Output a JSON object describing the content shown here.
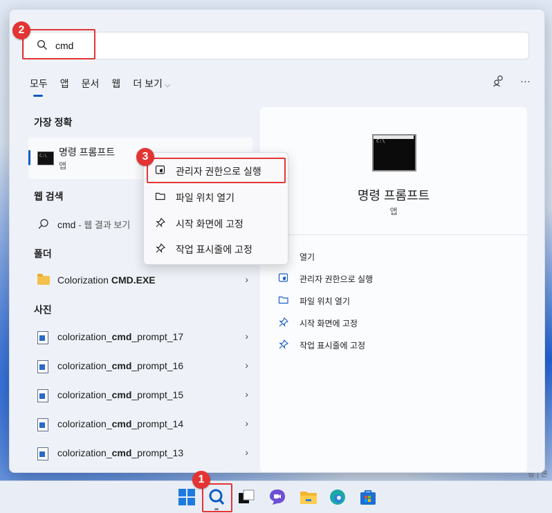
{
  "search": {
    "value": "cmd"
  },
  "tabs": [
    {
      "label": "모두",
      "active": true
    },
    {
      "label": "앱"
    },
    {
      "label": "문서"
    },
    {
      "label": "웹"
    },
    {
      "label": "더 보기"
    }
  ],
  "sections": {
    "best_match": "가장 정확",
    "web": "웹 검색",
    "folders": "폴더",
    "photos": "사진"
  },
  "best_match": {
    "title": "명령 프롬프트",
    "subtitle": "앱",
    "icon": "cmd-app-icon"
  },
  "web_result": {
    "query": "cmd",
    "suffix": "- 웹 결과 보기"
  },
  "folder_result": {
    "prefix": "Colorization ",
    "bold": "CMD.EXE"
  },
  "photos": [
    {
      "prefix": "colorization_",
      "bold": "cmd",
      "suffix": "_prompt_17"
    },
    {
      "prefix": "colorization_",
      "bold": "cmd",
      "suffix": "_prompt_16"
    },
    {
      "prefix": "colorization_",
      "bold": "cmd",
      "suffix": "_prompt_15"
    },
    {
      "prefix": "colorization_",
      "bold": "cmd",
      "suffix": "_prompt_14"
    },
    {
      "prefix": "colorization_",
      "bold": "cmd",
      "suffix": "_prompt_13"
    }
  ],
  "context_menu": [
    {
      "label": "관리자 권한으로 실행",
      "icon": "shield-icon"
    },
    {
      "label": "파일 위치 열기",
      "icon": "folder-open-icon"
    },
    {
      "label": "시작 화면에 고정",
      "icon": "pin-icon"
    },
    {
      "label": "작업 표시줄에 고정",
      "icon": "pin-icon"
    }
  ],
  "detail": {
    "title": "명령 프롬프트",
    "subtitle": "앱",
    "actions": [
      {
        "label": "열기",
        "icon": "open-icon"
      },
      {
        "label": "관리자 권한으로 실행",
        "icon": "shield-icon"
      },
      {
        "label": "파일 위치 열기",
        "icon": "folder-open-icon"
      },
      {
        "label": "시작 화면에 고정",
        "icon": "pin-icon"
      },
      {
        "label": "작업 표시줄에 고정",
        "icon": "pin-icon"
      }
    ]
  },
  "badges": [
    "1",
    "2",
    "3"
  ],
  "colors": {
    "accent": "#0a5cc4",
    "annotation": "#e33434"
  },
  "wallpaper_text": "정 | 본"
}
